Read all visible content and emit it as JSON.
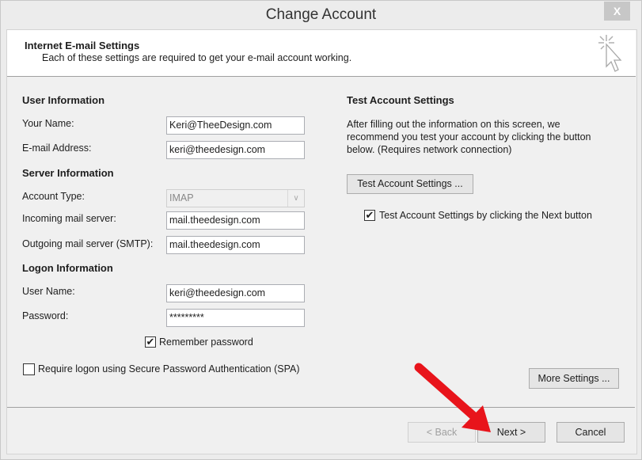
{
  "window": {
    "title": "Change Account",
    "close_label": "X"
  },
  "header": {
    "title": "Internet E-mail Settings",
    "subtitle": "Each of these settings are required to get your e-mail account working."
  },
  "user_info": {
    "heading": "User Information",
    "name_label": "Your Name:",
    "name_value": "Keri@TheeDesign.com",
    "email_label": "E-mail Address:",
    "email_value": "keri@theedesign.com"
  },
  "server_info": {
    "heading": "Server Information",
    "account_type_label": "Account Type:",
    "account_type_value": "IMAP",
    "incoming_label": "Incoming mail server:",
    "incoming_value": "mail.theedesign.com",
    "outgoing_label": "Outgoing mail server (SMTP):",
    "outgoing_value": "mail.theedesign.com"
  },
  "logon_info": {
    "heading": "Logon Information",
    "username_label": "User Name:",
    "username_value": "keri@theedesign.com",
    "password_label": "Password:",
    "password_value": "*********",
    "remember_label": "Remember password",
    "remember_checked": true,
    "spa_label": "Require logon using Secure Password Authentication (SPA)",
    "spa_checked": false
  },
  "test": {
    "heading": "Test Account Settings",
    "description": "After filling out the information on this screen, we recommend you test your account by clicking the button below. (Requires network connection)",
    "button": "Test Account Settings ...",
    "auto_label": "Test Account Settings by clicking the Next button",
    "auto_checked": true
  },
  "buttons": {
    "more": "More Settings ...",
    "back": "< Back",
    "next": "Next >",
    "cancel": "Cancel"
  },
  "annotation": {
    "arrow_color": "#e8141b"
  }
}
